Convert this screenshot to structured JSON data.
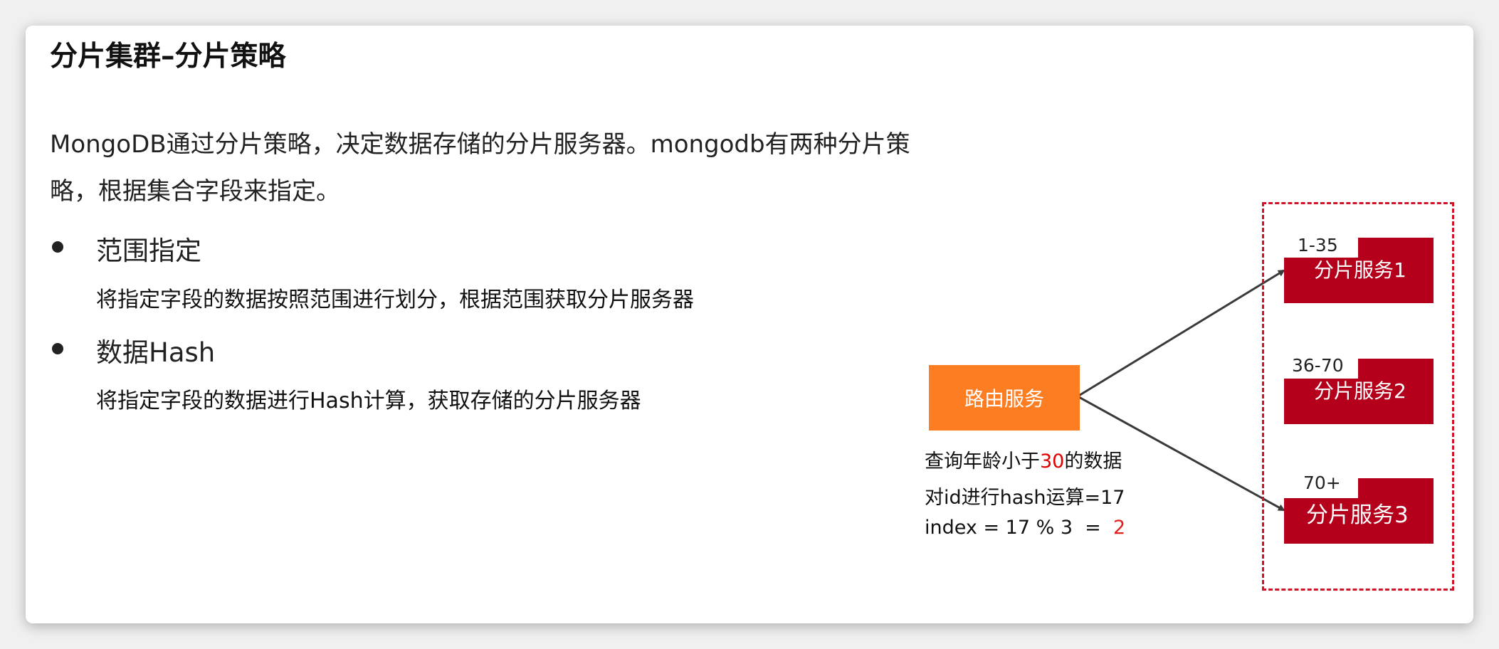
{
  "slide": {
    "title": "分片集群–分片策略",
    "intro": "MongoDB通过分片策略，决定数据存储的分片服务器。mongodb有两种分片策略，根据集合字段来指定。",
    "bullets": [
      {
        "heading": "范围指定",
        "description": "将指定字段的数据按照范围进行划分，根据范围获取分片服务器"
      },
      {
        "heading": "数据Hash",
        "description": "将指定字段的数据进行Hash计算，获取存储的分片服务器"
      }
    ]
  },
  "diagram": {
    "router": {
      "label": "路由服务"
    },
    "query": {
      "line1_prefix": "查询年龄小于",
      "line1_value": "30",
      "line1_suffix": "的数据",
      "line2": "对id进行hash运算=17",
      "line3_prefix": "index = 17 % 3  =",
      "line3_value": "2"
    },
    "servers": [
      {
        "range": "1-35",
        "label": "分片服务1"
      },
      {
        "range": "36-70",
        "label": "分片服务2"
      },
      {
        "range": "70+",
        "label": "分片服务3"
      }
    ],
    "colors": {
      "router": "#fd7e22",
      "server": "#b4001a",
      "frame": "#d21226",
      "highlight": "#e00000",
      "arrow": "#3a3a3a"
    }
  }
}
